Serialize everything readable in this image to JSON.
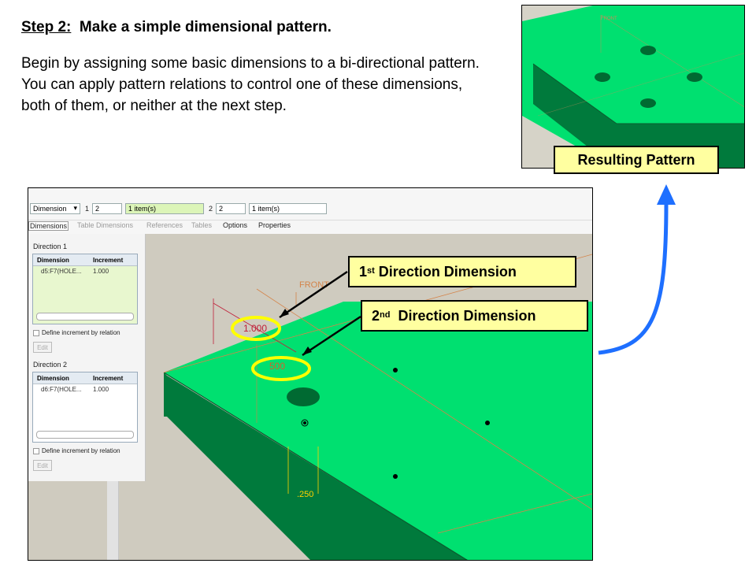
{
  "slide": {
    "step_label": "Step 2:",
    "title": "Make a simple dimensional pattern.",
    "body": "Begin by assigning some basic dimensions to a bi-directional pattern. You can apply pattern relations to control one of these dimensions, both of them, or neither at the next step."
  },
  "callouts": {
    "resulting": "Resulting Pattern",
    "first_sup": "st",
    "first_num": "1",
    "first_rest": " Direction Dimension",
    "second_num": "2",
    "second_sup": "nd",
    "second_rest": "  Direction Dimension"
  },
  "dashboard": {
    "type_select": "Dimension",
    "dir1_label": "1",
    "dir1_count": "2",
    "dir1_items": "1 item(s)",
    "dir2_label": "2",
    "dir2_count": "2",
    "dir2_items": "1 item(s)",
    "tabs": [
      "Dimensions",
      "Table Dimensions",
      "References",
      "Tables",
      "Options",
      "Properties"
    ]
  },
  "panel": {
    "direction1_title": "Direction 1",
    "direction2_title": "Direction 2",
    "col_dimension": "Dimension",
    "col_increment": "Increment",
    "dir1_row": {
      "dimension": "d5:F7(HOLE...",
      "increment": "1.000"
    },
    "dir2_row": {
      "dimension": "d6:F7(HOLE...",
      "increment": "1.000"
    },
    "checkbox_label": "Define increment by relation",
    "edit_label": "Edit"
  },
  "model": {
    "dim1_value": "1.000",
    "dim2_value": "500",
    "dim3_value": ".250",
    "plane_label": "FRONT",
    "result_plane_label": "FRONT"
  },
  "colors": {
    "model_green": "#00e070",
    "side_green": "#007a3c",
    "callout_fill": "#ffffa0",
    "highlight_ellipse": "#ffff00",
    "arrow_blue": "#1e6fff",
    "dim_red": "#c0203a"
  }
}
